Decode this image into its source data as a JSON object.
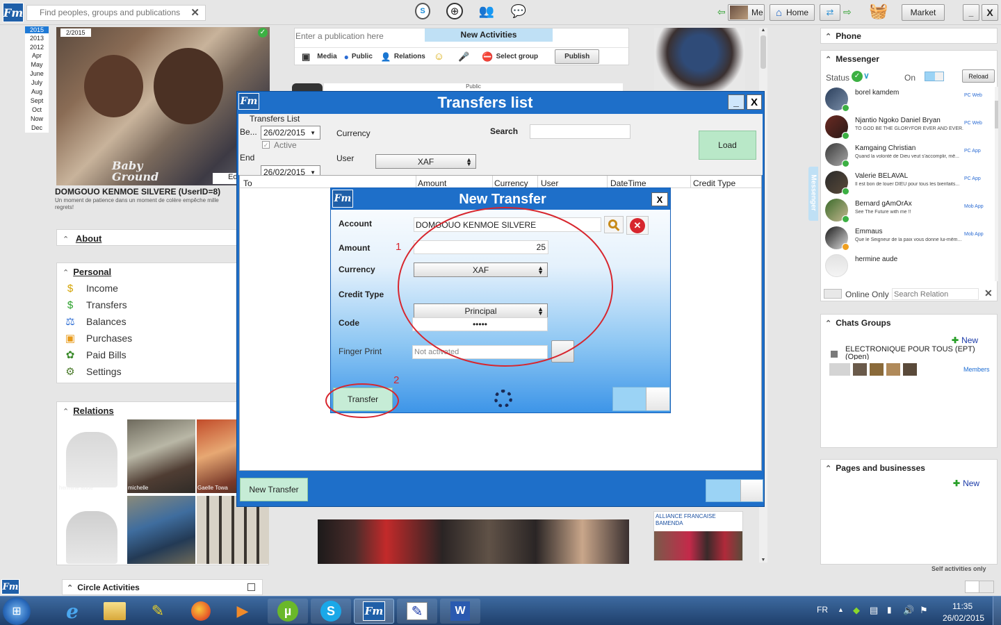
{
  "topbar": {
    "search_placeholder": "Find peoples, groups and publications",
    "me_label": "Me",
    "home_label": "Home",
    "market_label": "Market"
  },
  "timeline": {
    "years": [
      "2015",
      "2013",
      "2012"
    ],
    "months": [
      "Apr",
      "May",
      "June",
      "July",
      "Aug",
      "Sept",
      "Oct",
      "Now",
      "Dec"
    ]
  },
  "profile": {
    "photo_date": "2/2015",
    "photo_caption": "Baby Ground",
    "edit_label": "Edi",
    "name": "DOMGOUO KENMOE SILVERE (UserID=8)",
    "motto": "Un moment de patience dans un moment de colère empêche mille regrets!"
  },
  "left": {
    "about_label": "About",
    "personal_label": "Personal",
    "menu": [
      "Income",
      "Transfers",
      "Balances",
      "Purchases",
      "Paid Bills",
      "Settings"
    ],
    "relations_label": "Relations",
    "relations": [
      "hermine aude",
      "michelle",
      "Gaelle Towa"
    ],
    "circle_activities": "Circle Activities"
  },
  "publish": {
    "placeholder": "Enter a publication here",
    "new_activities": "New Activities",
    "media": "Media",
    "public": "Public",
    "relations": "Relations",
    "select_group": "Select group",
    "publish_btn": "Publish",
    "under_tab": "Public"
  },
  "transfers_window": {
    "title": "Transfers list",
    "group_label": "Transfers List",
    "begin_label": "Be...",
    "begin_date": "26/02/2015",
    "active_label": "Active",
    "end_label": "End",
    "end_date": "26/02/2015",
    "currency_label": "Currency",
    "currency_value": "XAF",
    "user_label": "User",
    "search_label": "Search",
    "load_btn": "Load",
    "columns": [
      "To",
      "Amount",
      "Currency",
      "User",
      "DateTime",
      "Credit Type"
    ],
    "new_transfer_btn": "New Transfer"
  },
  "new_transfer": {
    "title": "New Transfer",
    "account_label": "Account",
    "account_value": "DOMGOUO KENMOE SILVERE",
    "amount_label": "Amount",
    "amount_value": "25",
    "currency_label": "Currency",
    "currency_value": "XAF",
    "credit_type_label": "Credit Type",
    "credit_type_value": "Principal",
    "code_label": "Code",
    "code_value": "•••••",
    "fingerprint_label": "Finger Print",
    "fingerprint_value": "Not activated",
    "transfer_btn": "Transfer",
    "annotation_1": "1",
    "annotation_2": "2"
  },
  "right": {
    "phone": "Phone",
    "messenger": "Messenger",
    "status_label": "Status",
    "on_label": "On",
    "reload": "Reload",
    "vertical_tab": "Messenger",
    "contacts": [
      {
        "name": "borel kamdem",
        "msg": "",
        "device": "PC Web"
      },
      {
        "name": "Njantio Ngoko Daniel Bryan",
        "msg": "TO GOD BE THE GLORYFOR EVER AND EVER.",
        "device": "PC Web"
      },
      {
        "name": "Kamgaing Christian",
        "msg": "Quand la volonté de Dieu veut s'accomplir, mê...",
        "device": "PC App"
      },
      {
        "name": "Valerie BELAVAL",
        "msg": "Il est bon de louer DIEU pour tous les bienfaits...",
        "device": "PC App"
      },
      {
        "name": "Bernard gAmOrAx",
        "msg": "See The Future with me !!",
        "device": "Mob App"
      },
      {
        "name": "Emmaus",
        "msg": "Que le Seigneur de la paix vous donne lui-mêm...",
        "device": "Mob App"
      },
      {
        "name": "hermine aude",
        "msg": "",
        "device": ""
      }
    ],
    "online_only": "Online Only",
    "search_relation": "Search Relation",
    "chats_groups": "Chats Groups",
    "new_label": "New",
    "group_name": "ELECTRONIQUE POUR TOUS (EPT) (Open)",
    "members": "Members",
    "pages_businesses": "Pages and businesses",
    "pages_new": "New",
    "self_activities": "Self activities only"
  },
  "feed": {
    "card_title": "ALLIANCE FRANCAISE BAMENDA"
  },
  "taskbar": {
    "lang": "FR",
    "time": "11:35",
    "date": "26/02/2015"
  },
  "colors": {
    "brand": "#1f5fa8",
    "titlebar": "#1e6fc9",
    "accent_green": "#c6ecd6",
    "annotation_red": "#d7262e"
  }
}
